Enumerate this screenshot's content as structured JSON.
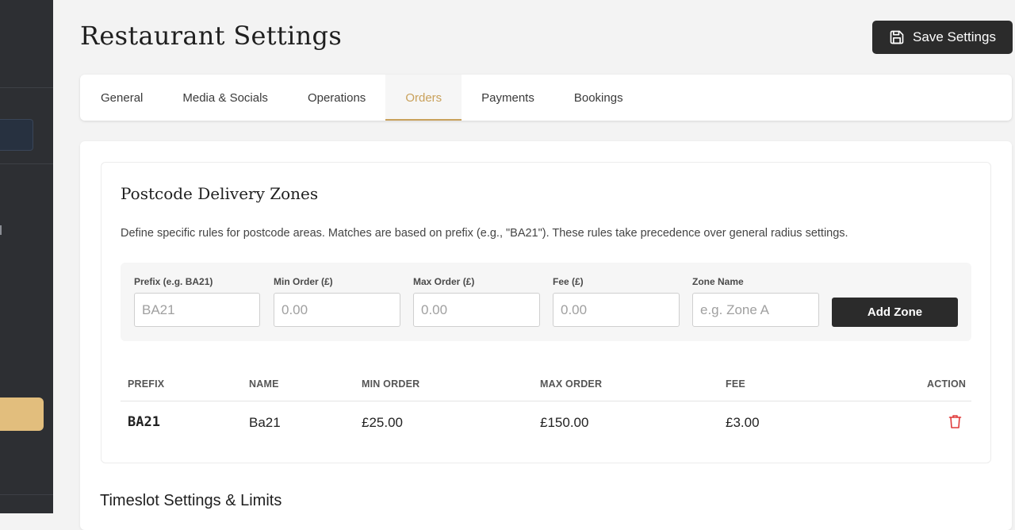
{
  "page": {
    "title": "Restaurant Settings",
    "save_label": "Save Settings"
  },
  "tabs": [
    {
      "label": "General",
      "active": false
    },
    {
      "label": "Media & Socials",
      "active": false
    },
    {
      "label": "Operations",
      "active": false
    },
    {
      "label": "Orders",
      "active": true
    },
    {
      "label": "Payments",
      "active": false
    },
    {
      "label": "Bookings",
      "active": false
    }
  ],
  "zones": {
    "title": "Postcode Delivery Zones",
    "description": "Define specific rules for postcode areas. Matches are based on prefix (e.g., \"BA21\"). These rules take precedence over general radius settings.",
    "form": {
      "prefix_label": "Prefix (e.g. BA21)",
      "prefix_placeholder": "BA21",
      "min_label": "Min Order (£)",
      "min_placeholder": "0.00",
      "max_label": "Max Order (£)",
      "max_placeholder": "0.00",
      "fee_label": "Fee (£)",
      "fee_placeholder": "0.00",
      "name_label": "Zone Name",
      "name_placeholder": "e.g. Zone A",
      "add_label": "Add Zone"
    },
    "table": {
      "headers": {
        "prefix": "PREFIX",
        "name": "NAME",
        "min": "MIN ORDER",
        "max": "MAX ORDER",
        "fee": "FEE",
        "action": "ACTION"
      },
      "rows": [
        {
          "prefix": "BA21",
          "name": "Ba21",
          "min": "£25.00",
          "max": "£150.00",
          "fee": "£3.00"
        }
      ]
    }
  },
  "timeslot": {
    "title": "Timeslot Settings & Limits"
  },
  "colors": {
    "accent": "#c9a15b",
    "sidebar": "#2d2f33",
    "danger": "#e03b3b"
  },
  "icons": {
    "save": "floppy-disk-icon",
    "delete": "trash-icon"
  }
}
